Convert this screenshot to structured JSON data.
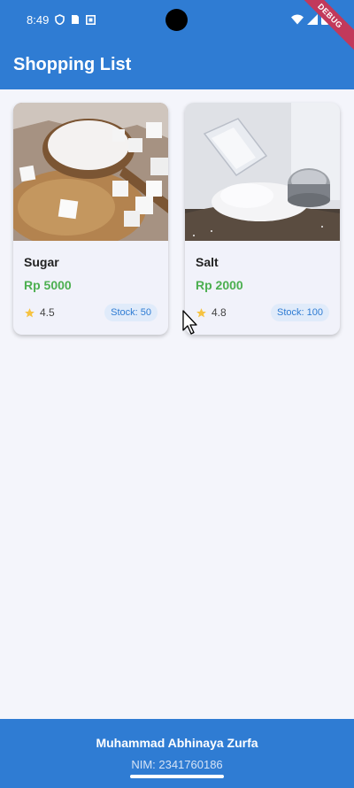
{
  "status_bar": {
    "time": "8:49",
    "left_icons": [
      "shield-icon",
      "sim-card-icon",
      "notification-icon"
    ],
    "right_icons": [
      "wifi-icon",
      "signal-icon",
      "battery-icon"
    ]
  },
  "debug_banner": "DEBUG",
  "app_bar": {
    "title": "Shopping List"
  },
  "products": [
    {
      "name": "Sugar",
      "price": "Rp 5000",
      "rating": "4.5",
      "stock": "Stock: 50",
      "image": "sugar-image"
    },
    {
      "name": "Salt",
      "price": "Rp 2000",
      "rating": "4.8",
      "stock": "Stock: 100",
      "image": "salt-image"
    }
  ],
  "footer": {
    "name": "Muhammad Abhinaya Zurfa",
    "nim": "NIM: 2341760186"
  },
  "colors": {
    "primary": "#2f7cd3",
    "price": "#4caf50",
    "star": "#f6c342",
    "debug": "#c2395b"
  }
}
